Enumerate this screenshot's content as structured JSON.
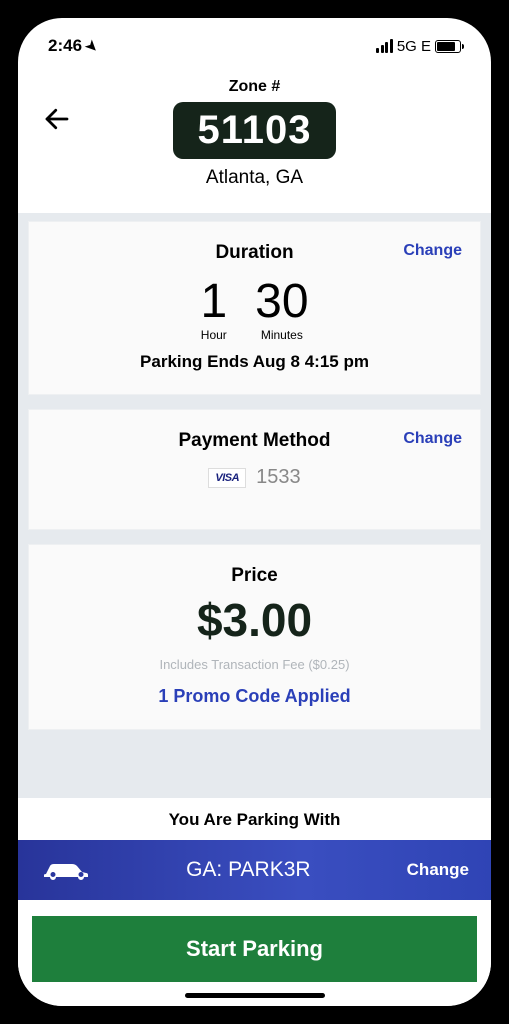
{
  "status": {
    "time": "2:46",
    "network": "5G E"
  },
  "header": {
    "zone_label": "Zone #",
    "zone_number": "51103",
    "location": "Atlanta, GA"
  },
  "duration": {
    "title": "Duration",
    "change_label": "Change",
    "hour_val": "1",
    "hour_unit": "Hour",
    "min_val": "30",
    "min_unit": "Minutes",
    "ends": "Parking Ends Aug 8 4:15 pm"
  },
  "payment": {
    "title": "Payment Method",
    "change_label": "Change",
    "card_brand": "VISA",
    "card_last4": "1533"
  },
  "price": {
    "title": "Price",
    "amount": "$3.00",
    "fee_note": "Includes Transaction Fee ($0.25)",
    "promo": "1 Promo Code Applied"
  },
  "vehicle": {
    "label": "You Are Parking With",
    "plate": "GA: PARK3R",
    "change_label": "Change"
  },
  "cta": {
    "start": "Start Parking"
  }
}
